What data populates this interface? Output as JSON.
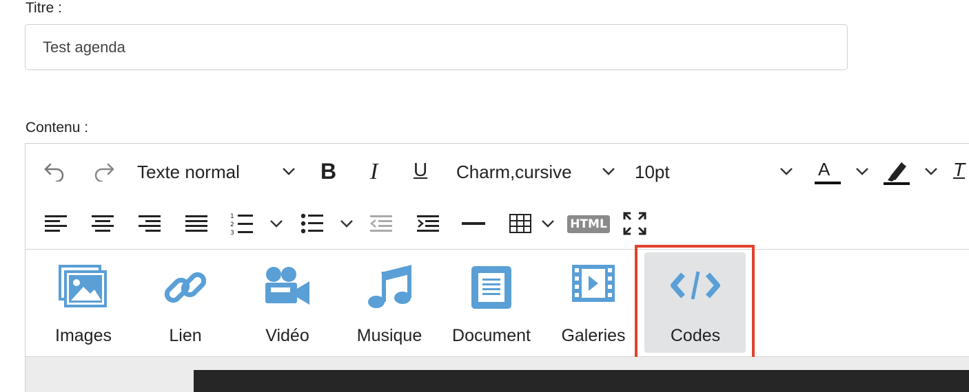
{
  "form": {
    "title_label": "Titre :",
    "title_value": "Test agenda",
    "content_label": "Contenu :"
  },
  "toolbar": {
    "row1": {
      "undo_icon": "undo-icon",
      "redo_icon": "redo-icon",
      "block_format": "Texte normal",
      "bold_label": "B",
      "italic_label": "I",
      "underline_label": "U",
      "font_family": "Charm,cursive",
      "font_size": "10pt",
      "text_color_label": "A",
      "clear_format_label": "T"
    },
    "row2": {
      "icons": [
        "align-left-icon",
        "align-center-icon",
        "align-right-icon",
        "align-justify-icon",
        "numbered-list-icon",
        "bullet-list-icon",
        "outdent-icon",
        "indent-icon",
        "horizontal-rule-icon",
        "table-icon",
        "html-icon",
        "fullscreen-icon"
      ],
      "html_badge": "HTML"
    }
  },
  "media": {
    "items": [
      {
        "label": "Images",
        "icon": "images-icon"
      },
      {
        "label": "Lien",
        "icon": "link-icon"
      },
      {
        "label": "Vidéo",
        "icon": "video-camera-icon"
      },
      {
        "label": "Musique",
        "icon": "music-note-icon"
      },
      {
        "label": "Document",
        "icon": "document-icon"
      },
      {
        "label": "Galeries",
        "icon": "film-strip-icon"
      },
      {
        "label": "Codes",
        "icon": "code-icon"
      }
    ],
    "active": "Codes"
  },
  "colors": {
    "icon_blue": "#5a9fd6",
    "highlight_red": "#e2412f",
    "active_bg": "#e2e3e5"
  }
}
